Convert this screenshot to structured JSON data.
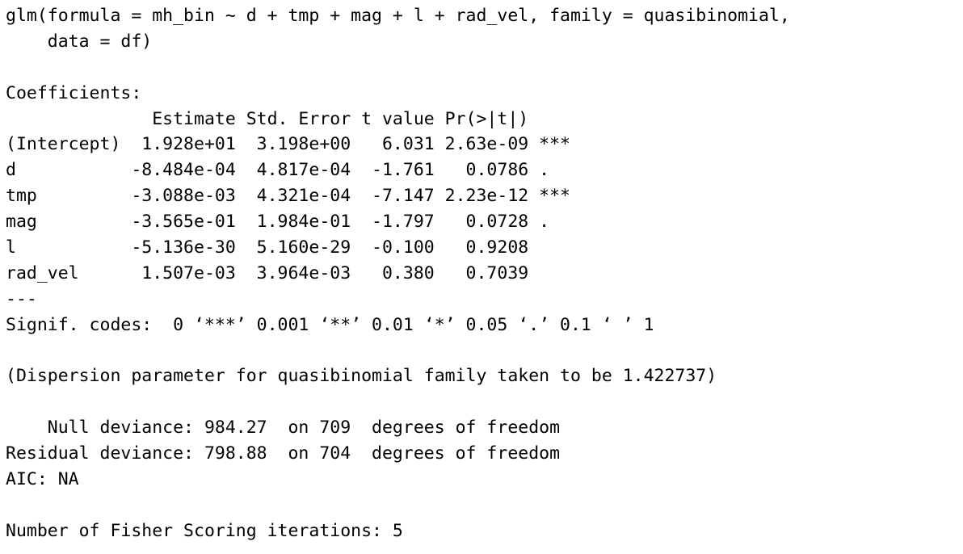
{
  "console": {
    "lines": [
      "glm(formula = mh_bin ~ d + tmp + mag + l + rad_vel, family = quasibinomial,",
      "    data = df)",
      "",
      "Coefficients:",
      "              Estimate Std. Error t value Pr(>|t|)    ",
      "(Intercept)  1.928e+01  3.198e+00   6.031 2.63e-09 ***",
      "d           -8.484e-04  4.817e-04  -1.761   0.0786 .  ",
      "tmp         -3.088e-03  4.321e-04  -7.147 2.23e-12 ***",
      "mag         -3.565e-01  1.984e-01  -1.797   0.0728 .  ",
      "l           -5.136e-30  5.160e-29  -0.100   0.9208    ",
      "rad_vel      1.507e-03  3.964e-03   0.380   0.7039    ",
      "---",
      "Signif. codes:  0 ‘***’ 0.001 ‘**’ 0.01 ‘*’ 0.05 ‘.’ 0.1 ‘ ’ 1",
      "",
      "(Dispersion parameter for quasibinomial family taken to be 1.422737)",
      "",
      "    Null deviance: 984.27  on 709  degrees of freedom",
      "Residual deviance: 798.88  on 704  degrees of freedom",
      "AIC: NA",
      "",
      "Number of Fisher Scoring iterations: 5"
    ]
  }
}
